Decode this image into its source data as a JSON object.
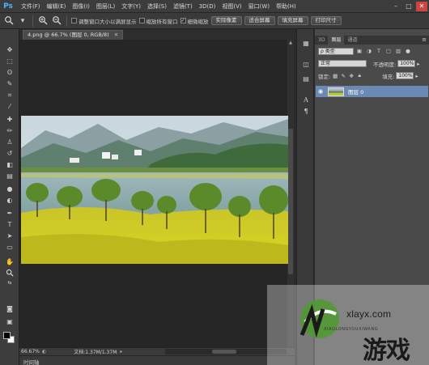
{
  "app": {
    "logo": "Ps"
  },
  "menubar": [
    "文件(F)",
    "编辑(E)",
    "图像(I)",
    "图层(L)",
    "文字(Y)",
    "选择(S)",
    "滤镜(T)",
    "3D(D)",
    "视图(V)",
    "窗口(W)",
    "帮助(H)"
  ],
  "window_controls": {
    "minimize": "–",
    "maximize": "□",
    "close": "✕"
  },
  "options": {
    "tool_icon": "zoom-icon",
    "resize_windows": {
      "label": "调整窗口大小以满屏显示",
      "checked": false
    },
    "zoom_all": {
      "label": "缩放所有窗口",
      "checked": false
    },
    "scrubby_zoom": {
      "label": "细微缩放",
      "checked": true
    },
    "actual_pixels": "实际像素",
    "fit_screen": "适合屏幕",
    "fill_screen": "填充屏幕",
    "print_size": "打印尺寸"
  },
  "document": {
    "tab_title": "4.png @ 66.7% (图层 0, RGB/8)",
    "close_glyph": "✕",
    "zoom": "66.67%",
    "info": "文档:1.37M/1.37M"
  },
  "timeline": {
    "label": "时间轴"
  },
  "panel": {
    "tabs": [
      "3D",
      "图层",
      "通道"
    ],
    "active_tab": "图层",
    "filter_kind": "ρ 类型",
    "blend_mode": "正常",
    "opacity_label": "不透明度:",
    "opacity_value": "100%",
    "lock_label": "锁定:",
    "fill_label": "填充:",
    "fill_value": "100%",
    "layer_name": "图层 0"
  },
  "watermark": {
    "domain": "xlayx.com",
    "pinyin": "XIAOLONGYOUXIWANG",
    "brand": "游戏"
  },
  "colors": {
    "accent_selection": "#6b89b2",
    "ps_logo": "#4fb3ff",
    "foreground_swatch": "#000000",
    "background_swatch": "#ffffff"
  }
}
